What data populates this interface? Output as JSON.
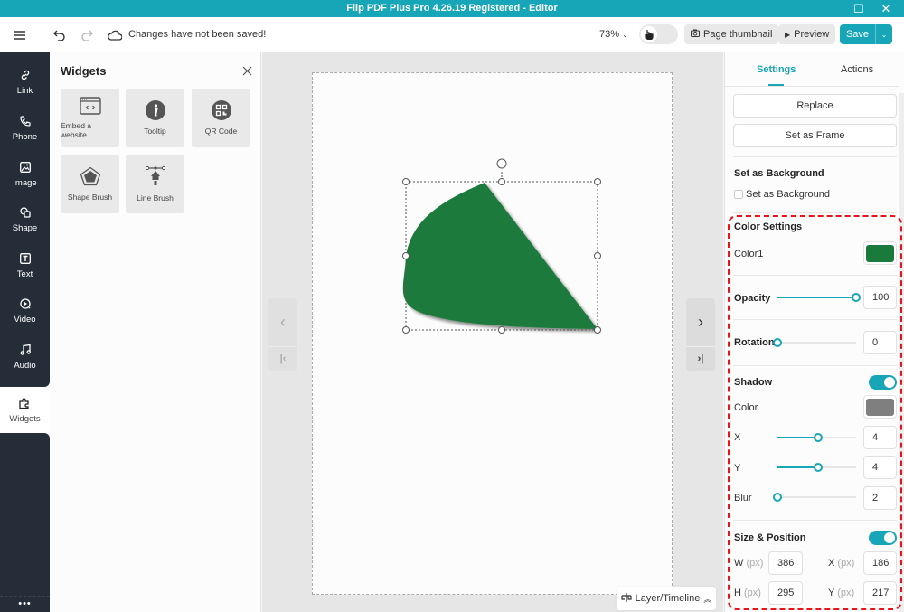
{
  "window": {
    "title": "Flip PDF Plus Pro 4.26.19 Registered - Editor",
    "maximize_icon": "maximize-icon",
    "close_icon": "close-icon"
  },
  "toolbar": {
    "menu_icon": "hamburger-menu-icon",
    "undo_icon": "undo-icon",
    "redo_icon": "redo-icon",
    "cloud_icon": "cloud-icon",
    "save_status": "Changes have not been saved!",
    "zoom_level": "73%",
    "hand_tool_icon": "hand-pointer-icon",
    "page_thumbnail_label": "Page thumbnail",
    "preview_label": "Preview",
    "save_label": "Save"
  },
  "sidebar": {
    "items": [
      {
        "label": "Link",
        "icon": "link-icon"
      },
      {
        "label": "Phone",
        "icon": "phone-icon"
      },
      {
        "label": "Image",
        "icon": "image-icon"
      },
      {
        "label": "Shape",
        "icon": "shape-icon"
      },
      {
        "label": "Text",
        "icon": "text-icon"
      },
      {
        "label": "Video",
        "icon": "video-icon"
      },
      {
        "label": "Audio",
        "icon": "audio-icon"
      },
      {
        "label": "Widgets",
        "icon": "widgets-puzzle-icon",
        "active": true
      }
    ],
    "more": "•••"
  },
  "widgets_panel": {
    "title": "Widgets",
    "items": [
      {
        "label": "Embed a website",
        "icon": "embed-website-icon"
      },
      {
        "label": "Tooltip",
        "icon": "tooltip-info-icon"
      },
      {
        "label": "QR Code",
        "icon": "qr-code-icon"
      },
      {
        "label": "Shape Brush",
        "icon": "shape-brush-icon"
      },
      {
        "label": "Line Brush",
        "icon": "line-brush-icon"
      }
    ]
  },
  "canvas": {
    "prev_label": "‹",
    "first_label": "|‹",
    "next_label": "›",
    "last_label": "›|",
    "layer_timeline_label": "Layer/Timeline",
    "shape_color": "#1a7a3c"
  },
  "right_panel": {
    "tabs": [
      {
        "label": "Settings",
        "active": true
      },
      {
        "label": "Actions",
        "active": false
      }
    ],
    "replace_label": "Replace",
    "set_as_frame_label": "Set as Frame",
    "background": {
      "heading": "Set as Background",
      "checkbox_label": "Set as Background",
      "checked": false
    },
    "color_settings": {
      "heading": "Color Settings",
      "color1_label": "Color1",
      "color1_value": "#1a7a3c"
    },
    "opacity": {
      "label": "Opacity",
      "value": "100",
      "fraction": 1.0
    },
    "rotation": {
      "label": "Rotation",
      "value": "0",
      "fraction": 0.0
    },
    "shadow": {
      "heading": "Shadow",
      "enabled": true,
      "color_label": "Color",
      "color_value": "#7f7f7f",
      "x_label": "X",
      "x_value": "4",
      "x_fraction": 0.52,
      "y_label": "Y",
      "y_value": "4",
      "y_fraction": 0.52,
      "blur_label": "Blur",
      "blur_value": "2",
      "blur_fraction": 0.0
    },
    "size_position": {
      "heading": "Size & Position",
      "enabled": true,
      "unit": "(px)",
      "w_label": "W",
      "w_value": "386",
      "h_label": "H",
      "h_value": "295",
      "x_label": "X",
      "x_value": "186",
      "y_label": "Y",
      "y_value": "217"
    }
  },
  "colors": {
    "accent": "#17a5b8",
    "sidebar_dark": "#252e38",
    "highlight": "#e8141a"
  }
}
